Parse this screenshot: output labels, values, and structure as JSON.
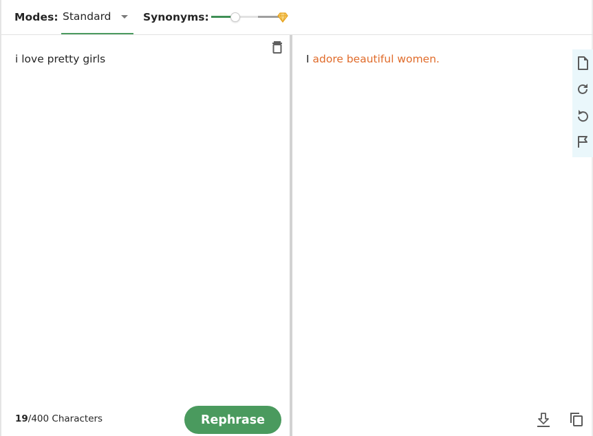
{
  "toolbar": {
    "modes_label": "Modes:",
    "mode_selected": "Standard",
    "synonyms_label": "Synonyms:",
    "synonyms_level_percent": 33
  },
  "input": {
    "text": "i love pretty girls",
    "char_count": "19",
    "char_limit": "/400 Characters",
    "rephrase_label": "Rephrase"
  },
  "output": {
    "unchanged_word": "I",
    "changed_text": "adore beautiful women."
  },
  "icons": {
    "trash": "trash-icon",
    "document": "document-icon",
    "redo": "redo-icon",
    "undo": "undo-icon",
    "flag": "flag-icon",
    "download": "download-icon",
    "copy": "copy-icon",
    "premium": "diamond-icon"
  },
  "colors": {
    "accent": "#4a9a5e",
    "changed_text": "#e06b2a",
    "premium": "#e6a21c",
    "sidebar_bg": "#eaf7fb"
  }
}
